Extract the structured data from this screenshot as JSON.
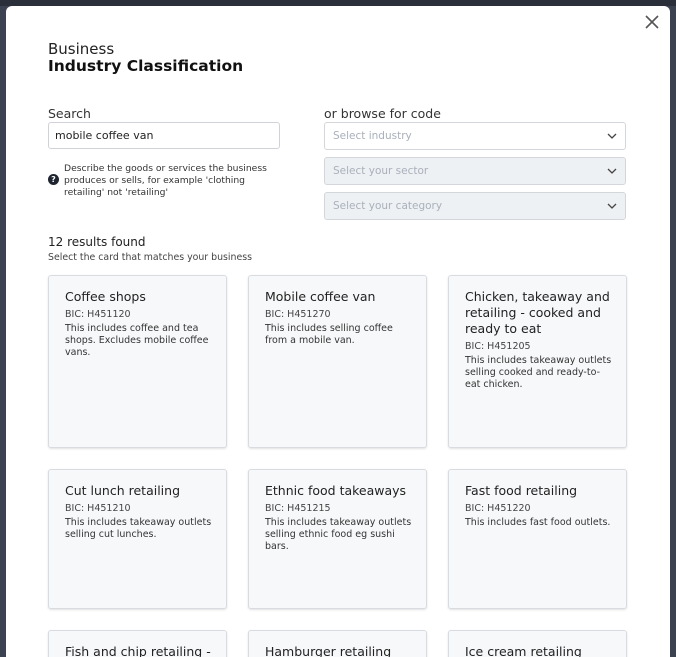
{
  "header": {
    "title_small": "Business",
    "title_bold": "Industry Classification"
  },
  "search": {
    "label": "Search",
    "value": "mobile coffee van",
    "hint": "Describe the goods or services the business produces or sells, for example 'clothing retailing' not 'retailing'"
  },
  "browse": {
    "label": "or browse for code",
    "industry_placeholder": "Select industry",
    "sector_placeholder": "Select your sector",
    "category_placeholder": "Select your category"
  },
  "results": {
    "count_text": "12 results found",
    "hint": "Select the card that matches your business",
    "cards": [
      {
        "title": "Coffee shops",
        "code": "BIC: H451120",
        "desc": "This includes coffee and tea shops. Excludes mobile coffee vans."
      },
      {
        "title": "Mobile coffee van",
        "code": "BIC: H451270",
        "desc": "This includes selling coffee from a mobile van."
      },
      {
        "title": "Chicken, takeaway and retailing - cooked and ready to eat",
        "code": "BIC: H451205",
        "desc": "This includes takeaway outlets selling cooked and ready-to-eat chicken."
      },
      {
        "title": "Cut lunch retailing",
        "code": "BIC: H451210",
        "desc": "This includes takeaway outlets selling cut lunches."
      },
      {
        "title": "Ethnic food takeaways",
        "code": "BIC: H451215",
        "desc": "This includes takeaway outlets selling ethnic food eg sushi bars."
      },
      {
        "title": "Fast food retailing",
        "code": "BIC: H451220",
        "desc": "This includes fast food outlets."
      },
      {
        "title": "Fish and chip retailing -",
        "code": "",
        "desc": ""
      },
      {
        "title": "Hamburger retailing",
        "code": "",
        "desc": ""
      },
      {
        "title": "Ice cream retailing",
        "code": "",
        "desc": ""
      }
    ]
  }
}
